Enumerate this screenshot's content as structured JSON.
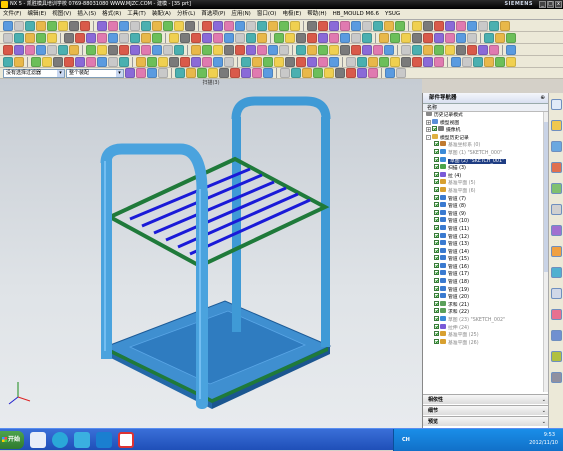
{
  "window": {
    "title": "NX 5 - 凯胜模具培训学校 0769-88031080 WWW.MJZC.COM - 建模 - [35 prt]",
    "brand": "SIEMENS"
  },
  "menu": [
    "文件(F)",
    "编辑(E)",
    "视图(V)",
    "插入(S)",
    "格式(R)",
    "工具(T)",
    "装配(A)",
    "分析(L)",
    "首选项(P)",
    "应用(N)",
    "窗口(O)",
    "电极(E)",
    "帮助(H)",
    "HB_MOULD M6.6",
    "YSUG"
  ],
  "filters": {
    "selection_filter": "没有选择过滤器",
    "scope": "整个装配"
  },
  "viewport": {
    "title": "扫描(3)"
  },
  "navigator": {
    "title": "部件导航器",
    "column": "名称",
    "items": [
      {
        "label": "历史记录模式",
        "type": "mode",
        "level": 0,
        "expand": "",
        "check": false,
        "dim": false
      },
      {
        "label": "模型视图",
        "type": "views",
        "level": 0,
        "expand": "+",
        "check": false,
        "dim": false
      },
      {
        "label": "摄像机",
        "type": "camera",
        "level": 0,
        "expand": "+",
        "check": true,
        "dim": false
      },
      {
        "label": "模型历史记录",
        "type": "history",
        "level": 0,
        "expand": "-",
        "check": false,
        "dim": false
      },
      {
        "label": "基准坐标系 (0)",
        "type": "datum",
        "level": 1,
        "expand": "",
        "check": true,
        "dim": true
      },
      {
        "label": "草图 (1) \"SKETCH_000\"",
        "type": "sketch",
        "level": 1,
        "expand": "",
        "check": true,
        "dim": true
      },
      {
        "label": "草图 (2) \"SKETCH_001\"",
        "type": "sketch",
        "level": 1,
        "expand": "",
        "check": true,
        "dim": false,
        "selected": true
      },
      {
        "label": "扫描 (3)",
        "type": "sweep",
        "level": 1,
        "expand": "",
        "check": true,
        "dim": false
      },
      {
        "label": "拉 (4)",
        "type": "extrude",
        "level": 1,
        "expand": "",
        "check": true,
        "dim": false
      },
      {
        "label": "基准平面 (5)",
        "type": "plane",
        "level": 1,
        "expand": "",
        "check": true,
        "dim": true
      },
      {
        "label": "基准平面 (6)",
        "type": "plane",
        "level": 1,
        "expand": "",
        "check": true,
        "dim": true
      },
      {
        "label": "管道 (7)",
        "type": "tube",
        "level": 1,
        "expand": "",
        "check": true,
        "dim": false
      },
      {
        "label": "管道 (8)",
        "type": "tube",
        "level": 1,
        "expand": "",
        "check": true,
        "dim": false
      },
      {
        "label": "管道 (9)",
        "type": "tube",
        "level": 1,
        "expand": "",
        "check": true,
        "dim": false
      },
      {
        "label": "管道 (10)",
        "type": "tube",
        "level": 1,
        "expand": "",
        "check": true,
        "dim": false
      },
      {
        "label": "管道 (11)",
        "type": "tube",
        "level": 1,
        "expand": "",
        "check": true,
        "dim": false
      },
      {
        "label": "管道 (12)",
        "type": "tube",
        "level": 1,
        "expand": "",
        "check": true,
        "dim": false
      },
      {
        "label": "管道 (13)",
        "type": "tube",
        "level": 1,
        "expand": "",
        "check": true,
        "dim": false
      },
      {
        "label": "管道 (14)",
        "type": "tube",
        "level": 1,
        "expand": "",
        "check": true,
        "dim": false
      },
      {
        "label": "管道 (15)",
        "type": "tube",
        "level": 1,
        "expand": "",
        "check": true,
        "dim": false
      },
      {
        "label": "管道 (16)",
        "type": "tube",
        "level": 1,
        "expand": "",
        "check": true,
        "dim": false
      },
      {
        "label": "管道 (17)",
        "type": "tube",
        "level": 1,
        "expand": "",
        "check": true,
        "dim": false
      },
      {
        "label": "管道 (18)",
        "type": "tube",
        "level": 1,
        "expand": "",
        "check": true,
        "dim": false
      },
      {
        "label": "管道 (19)",
        "type": "tube",
        "level": 1,
        "expand": "",
        "check": true,
        "dim": false
      },
      {
        "label": "管道 (20)",
        "type": "tube",
        "level": 1,
        "expand": "",
        "check": true,
        "dim": false
      },
      {
        "label": "求和 (21)",
        "type": "unite",
        "level": 1,
        "expand": "",
        "check": true,
        "dim": false
      },
      {
        "label": "求和 (22)",
        "type": "unite",
        "level": 1,
        "expand": "",
        "check": true,
        "dim": false
      },
      {
        "label": "草图 (23) \"SKETCH_002\"",
        "type": "sketch",
        "level": 1,
        "expand": "",
        "check": true,
        "dim": true
      },
      {
        "label": "拉伸 (24)",
        "type": "extrude",
        "level": 1,
        "expand": "",
        "check": true,
        "dim": true
      },
      {
        "label": "基准平面 (25)",
        "type": "plane",
        "level": 1,
        "expand": "",
        "check": true,
        "dim": true
      },
      {
        "label": "基准平面 (26)",
        "type": "plane",
        "level": 1,
        "expand": "",
        "check": true,
        "dim": true
      }
    ],
    "panels": [
      "相依性",
      "细节",
      "预览"
    ]
  },
  "taskbar": {
    "start": "开始",
    "lang": "CH",
    "time": "9:53",
    "date": "2012/11/10"
  },
  "colors": {
    "tube": "#3f9ad6",
    "frame": "#1f7a3a",
    "slats": "#1a1ad8",
    "tray": "#3f8fd0",
    "selection": "#1f3d83"
  }
}
